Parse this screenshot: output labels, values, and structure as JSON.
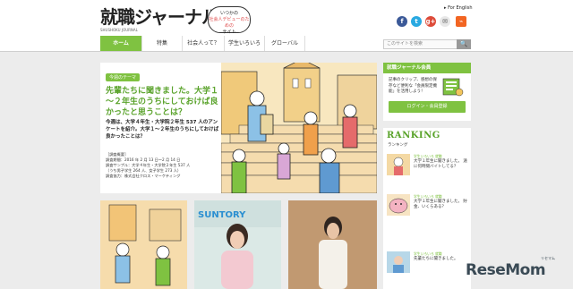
{
  "header": {
    "logo": "就職ジャーナル",
    "logo_sub": "SHUSHOKU JOURNAL",
    "tagline": [
      "いつかの",
      "社会人デビューのための",
      "サイト"
    ],
    "for_english": "▸ For English",
    "social": {
      "facebook": "f",
      "twitter": "t",
      "google": "g+",
      "mail": "✉",
      "rss": "⌁"
    }
  },
  "nav": {
    "items": [
      "ホーム",
      "特集",
      "社会人って？",
      "学生いろいろ",
      "グローバル"
    ],
    "search_placeholder": "このサイトを検索",
    "search_icon": "🔍"
  },
  "feature": {
    "badge": "今週のテーマ",
    "headline": "先輩たちに聞きました。大学１～２年生のうちにしておけば良かったと思うことは？",
    "lead": "今週は、大学４年生・大学院２年生 537 人のアンケートを紹介。大学１～２年生のうちにしておけば良かったことは？",
    "survey_title": "［調査概要］",
    "survey_period": "調査期間：2016 年 2 月 13 日～2 月 14 日",
    "survey_sample": "調査サンプル：大学４年生・大学院２年生 537 人",
    "survey_sample_detail": "（うち男子学生 264 人、女子学生 273 人）",
    "survey_org": "調査協力：株式会社クロス・マーケティング"
  },
  "sidebar": {
    "member_title": "就職ジャーナル会員",
    "member_desc": "記事のクリップ、感想の保存など便利な「会員限定機能」を活用しよう！",
    "login_label": "ログイン・会員登録",
    "ranking_title": "RANKING",
    "ranking_sub": "ランキング",
    "ranking_items": [
      {
        "cat": "学生いろいろ 就職",
        "title": "大学１年生に聞きました。 遠に何時間バイトしてる？"
      },
      {
        "cat": "学生いろいろ 就職",
        "title": "大学１年生に聞きました。 貯金、いくらある？"
      },
      {
        "cat": "学生いろいろ 就職",
        "title": "先輩たちに聞きました。"
      }
    ]
  },
  "cards": {
    "card2_brand": "SUNTORY"
  },
  "watermark": {
    "text": "ReseMom",
    "sub": "リセマム"
  }
}
